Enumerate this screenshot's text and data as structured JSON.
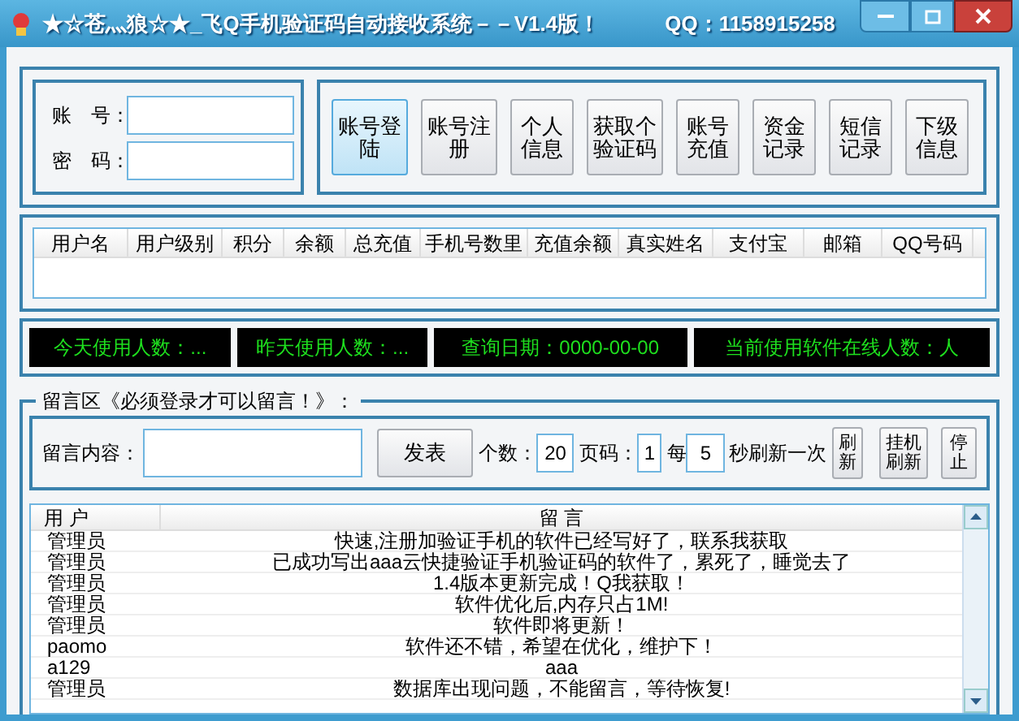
{
  "window": {
    "title": "★☆苍灬狼☆★_飞Q手机验证码自动接收系统－－V1.4版！",
    "qq": "QQ：1158915258"
  },
  "login": {
    "fields": [
      {
        "label": "账　号："
      },
      {
        "label": "密　码："
      }
    ]
  },
  "buttons": [
    {
      "label": "账号登陆",
      "selected": true
    },
    {
      "label": "账号注册",
      "selected": false
    },
    {
      "label": "个人信息",
      "selected": false
    },
    {
      "label": "获取个验证码",
      "selected": false
    },
    {
      "label": "账号充值",
      "selected": false
    },
    {
      "label": "资金记录",
      "selected": false
    },
    {
      "label": "短信记录",
      "selected": false
    },
    {
      "label": "下级信息",
      "selected": false
    }
  ],
  "user_table": {
    "columns": [
      "用户名",
      "用户级别",
      "积分",
      "余额",
      "总充值",
      "手机号数里",
      "充值余额",
      "真实姓名",
      "支付宝",
      "邮箱",
      "QQ号码"
    ]
  },
  "status_panels": [
    "今天使用人数：...",
    "昨天使用人数：...",
    "查询日期：0000-00-00",
    "当前使用软件在线人数：人"
  ],
  "message_area": {
    "title": "留言区《必须登录才可以留言！》：",
    "content_label": "留言内容：",
    "post_button": "发表",
    "count_label": "个数：",
    "count": "20",
    "page_label": "页码：",
    "page": "1",
    "every_label": "每",
    "interval": "5",
    "interval_suffix": "秒刷新一次",
    "action_buttons": [
      "刷新",
      "挂机刷新",
      "停止"
    ]
  },
  "message_list": {
    "columns": [
      "用 户",
      "留 言"
    ],
    "rows": [
      {
        "user": "管理员",
        "message": "快速,注册加验证手机的软件已经写好了，联系我获取"
      },
      {
        "user": "管理员",
        "message": "已成功写出aaa云快捷验证手机验证码的软件了，累死了，睡觉去了"
      },
      {
        "user": "管理员",
        "message": "1.4版本更新完成！Q我获取！"
      },
      {
        "user": "管理员",
        "message": "软件优化后,内存只占1M!"
      },
      {
        "user": "管理员",
        "message": "软件即将更新！"
      },
      {
        "user": "paomo",
        "message": "软件还不错，希望在优化，维护下！"
      },
      {
        "user": "a129",
        "message": "aaa"
      },
      {
        "user": "管理员",
        "message": "数据库出现问题，不能留言，等待恢复!"
      }
    ]
  }
}
